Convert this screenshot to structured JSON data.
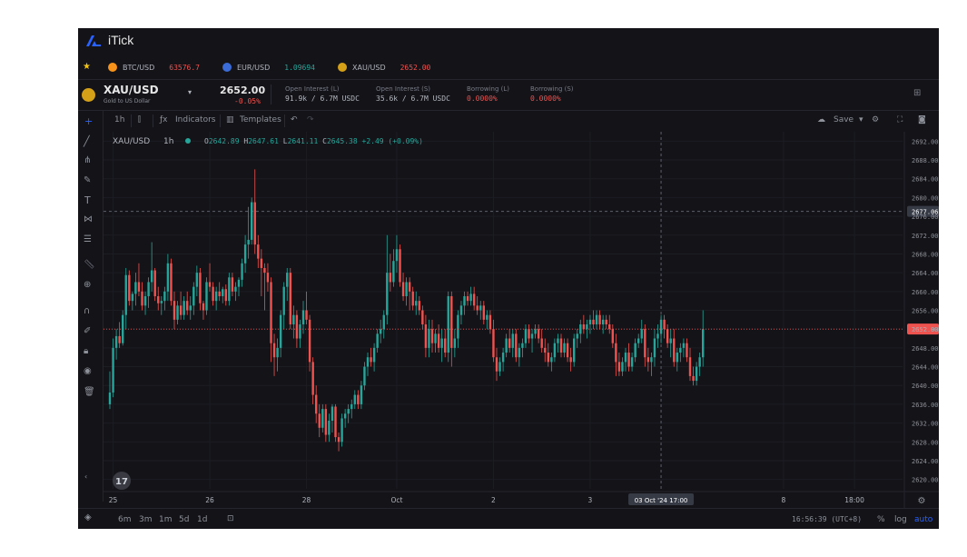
{
  "app": {
    "title": "iTick"
  },
  "watchlist": [
    {
      "symbol": "BTC/USD",
      "price": "63576.7",
      "price_color": "#ef5350",
      "coin_color": "#f7931a"
    },
    {
      "symbol": "EUR/USD",
      "price": "1.09694",
      "price_color": "#26a69a",
      "coin_color": "#3b6bd6"
    },
    {
      "symbol": "XAU/USD",
      "price": "2652.00",
      "price_color": "#ef5350",
      "coin_color": "#d4a017"
    }
  ],
  "symbol_header": {
    "symbol": "XAU/USD",
    "description": "Gold to US Dollar",
    "price": "2652.00",
    "change": "-0.05%",
    "stats": [
      {
        "label": "Open Interest (L)",
        "value": "91.9k / 6.7M USDC",
        "color": "#b2b5be"
      },
      {
        "label": "Open Interest (S)",
        "value": "35.6k / 6.7M USDC",
        "color": "#b2b5be"
      },
      {
        "label": "Borrowing (L)",
        "value": "0.0000%",
        "color": "#ef5350"
      },
      {
        "label": "Borrowing (S)",
        "value": "0.0000%",
        "color": "#ef5350"
      }
    ]
  },
  "toolbar": {
    "interval": "1h",
    "indicators": "Indicators",
    "templates": "Templates",
    "save": "Save"
  },
  "legend": {
    "symbol": "XAU/USD",
    "interval": "1h",
    "o": "2642.89",
    "h": "2647.61",
    "l": "2641.11",
    "c": "2645.38",
    "change": "+2.49 (+0.09%)"
  },
  "bottom": {
    "ranges": [
      "6m",
      "3m",
      "1m",
      "5d",
      "1d"
    ],
    "time": "16:56:39 (UTC+8)",
    "pct": "%",
    "log": "log",
    "auto": "auto"
  },
  "colors": {
    "up": "#26a69a",
    "down": "#ef5350",
    "accent": "#2962ff"
  },
  "chart_data": {
    "type": "candlestick",
    "title": "XAU/USD 1h",
    "ylim": [
      2618,
      2694
    ],
    "y_ticks": [
      "2692.00",
      "2688.00",
      "2684.00",
      "2680.00",
      "2676.00",
      "2672.00",
      "2668.00",
      "2664.00",
      "2660.00",
      "2656.00",
      "2652.00",
      "2648.00",
      "2644.00",
      "2640.00",
      "2636.00",
      "2632.00",
      "2628.00",
      "2624.00",
      "2620.00"
    ],
    "x_ticks": [
      {
        "label": "25",
        "bar": 1
      },
      {
        "label": "26",
        "bar": 31
      },
      {
        "label": "28",
        "bar": 61
      },
      {
        "label": "Oct",
        "bar": 89
      },
      {
        "label": "2",
        "bar": 119
      },
      {
        "label": "3",
        "bar": 149
      },
      {
        "label": "8",
        "bar": 209
      },
      {
        "label": "18:00",
        "bar": 231
      }
    ],
    "last_price": "2652.00",
    "last_price_value": 2652.0,
    "crosshair_price": "2677.06",
    "crosshair_price_value": 2677.06,
    "crosshair_time": "03 Oct '24  17:00",
    "crosshair_bar": 171,
    "ohlc": [
      [
        2636.0,
        2643.0,
        2635.0,
        2638.5
      ],
      [
        2638.5,
        2650.0,
        2637.5,
        2648.0
      ],
      [
        2648.0,
        2652.0,
        2645.5,
        2650.5
      ],
      [
        2650.5,
        2653.5,
        2648.0,
        2649.0
      ],
      [
        2649.0,
        2656.0,
        2648.5,
        2655.0
      ],
      [
        2655.0,
        2665.0,
        2652.0,
        2663.5
      ],
      [
        2663.5,
        2664.5,
        2657.0,
        2658.0
      ],
      [
        2658.0,
        2660.0,
        2656.0,
        2659.5
      ],
      [
        2659.5,
        2664.0,
        2657.0,
        2662.0
      ],
      [
        2662.0,
        2666.0,
        2659.0,
        2660.0
      ],
      [
        2660.0,
        2662.0,
        2656.0,
        2657.0
      ],
      [
        2657.0,
        2660.0,
        2655.0,
        2659.0
      ],
      [
        2659.0,
        2663.0,
        2656.5,
        2662.0
      ],
      [
        2662.0,
        2670.5,
        2660.0,
        2664.5
      ],
      [
        2664.5,
        2665.0,
        2658.0,
        2659.0
      ],
      [
        2659.0,
        2661.0,
        2656.0,
        2657.5
      ],
      [
        2657.5,
        2659.0,
        2655.0,
        2658.0
      ],
      [
        2658.0,
        2661.0,
        2656.0,
        2660.0
      ],
      [
        2660.0,
        2668.0,
        2658.0,
        2666.0
      ],
      [
        2666.0,
        2667.0,
        2657.0,
        2658.0
      ],
      [
        2658.0,
        2660.0,
        2652.0,
        2654.0
      ],
      [
        2654.0,
        2658.0,
        2653.0,
        2657.0
      ],
      [
        2657.0,
        2660.0,
        2654.0,
        2655.0
      ],
      [
        2655.0,
        2659.0,
        2654.0,
        2658.0
      ],
      [
        2658.0,
        2660.0,
        2655.0,
        2656.0
      ],
      [
        2656.0,
        2659.0,
        2654.0,
        2657.0
      ],
      [
        2657.0,
        2662.0,
        2655.0,
        2661.0
      ],
      [
        2661.0,
        2665.5,
        2659.0,
        2664.0
      ],
      [
        2664.0,
        2665.0,
        2656.0,
        2657.5
      ],
      [
        2657.5,
        2658.0,
        2654.0,
        2656.0
      ],
      [
        2656.0,
        2663.0,
        2655.0,
        2662.0
      ],
      [
        2662.0,
        2666.0,
        2660.0,
        2661.0
      ],
      [
        2661.0,
        2662.0,
        2657.0,
        2658.0
      ],
      [
        2658.0,
        2661.0,
        2656.0,
        2660.0
      ],
      [
        2660.0,
        2662.0,
        2658.0,
        2659.0
      ],
      [
        2659.0,
        2661.0,
        2657.5,
        2660.5
      ],
      [
        2660.5,
        2661.5,
        2657.0,
        2658.0
      ],
      [
        2658.0,
        2664.0,
        2657.0,
        2663.0
      ],
      [
        2663.0,
        2664.0,
        2659.0,
        2660.0
      ],
      [
        2660.0,
        2662.0,
        2658.0,
        2661.0
      ],
      [
        2661.0,
        2663.0,
        2659.0,
        2662.5
      ],
      [
        2662.5,
        2667.0,
        2661.0,
        2666.0
      ],
      [
        2666.0,
        2672.0,
        2664.0,
        2670.0
      ],
      [
        2670.0,
        2678.0,
        2667.0,
        2671.0
      ],
      [
        2671.0,
        2680.0,
        2670.0,
        2679.0
      ],
      [
        2679.0,
        2686.0,
        2668.0,
        2670.0
      ],
      [
        2670.0,
        2672.0,
        2665.0,
        2667.0
      ],
      [
        2667.0,
        2669.0,
        2659.0,
        2665.0
      ],
      [
        2665.0,
        2666.0,
        2656.0,
        2664.0
      ],
      [
        2664.0,
        2666.0,
        2660.0,
        2662.0
      ],
      [
        2662.0,
        2663.0,
        2645.0,
        2649.0
      ],
      [
        2649.0,
        2651.0,
        2642.0,
        2646.0
      ],
      [
        2646.0,
        2650.0,
        2643.0,
        2648.0
      ],
      [
        2648.0,
        2656.0,
        2646.0,
        2655.0
      ],
      [
        2655.0,
        2662.0,
        2652.0,
        2661.0
      ],
      [
        2661.0,
        2665.0,
        2658.0,
        2664.0
      ],
      [
        2664.0,
        2665.0,
        2652.0,
        2653.0
      ],
      [
        2653.0,
        2657.0,
        2650.0,
        2655.0
      ],
      [
        2655.0,
        2656.0,
        2648.0,
        2650.0
      ],
      [
        2650.0,
        2654.0,
        2648.0,
        2653.0
      ],
      [
        2653.0,
        2658.0,
        2651.0,
        2656.0
      ],
      [
        2656.0,
        2660.0,
        2653.0,
        2654.0
      ],
      [
        2654.0,
        2655.0,
        2643.0,
        2645.0
      ],
      [
        2645.0,
        2646.0,
        2636.0,
        2638.0
      ],
      [
        2638.0,
        2640.0,
        2632.0,
        2634.0
      ],
      [
        2634.0,
        2636.0,
        2629.0,
        2631.0
      ],
      [
        2631.0,
        2636.0,
        2630.0,
        2635.0
      ],
      [
        2635.0,
        2636.0,
        2628.0,
        2629.5
      ],
      [
        2629.5,
        2634.0,
        2628.0,
        2632.5
      ],
      [
        2632.5,
        2636.0,
        2630.0,
        2635.5
      ],
      [
        2635.5,
        2636.0,
        2628.0,
        2629.0
      ],
      [
        2629.0,
        2630.0,
        2626.0,
        2628.0
      ],
      [
        2628.0,
        2634.0,
        2627.0,
        2633.0
      ],
      [
        2633.0,
        2635.0,
        2631.0,
        2634.0
      ],
      [
        2634.0,
        2636.0,
        2632.0,
        2635.0
      ],
      [
        2635.0,
        2637.0,
        2633.0,
        2636.0
      ],
      [
        2636.0,
        2639.0,
        2635.0,
        2638.0
      ],
      [
        2638.0,
        2639.0,
        2635.0,
        2636.0
      ],
      [
        2636.0,
        2641.0,
        2635.0,
        2640.0
      ],
      [
        2640.0,
        2645.0,
        2639.0,
        2644.0
      ],
      [
        2644.0,
        2647.0,
        2642.0,
        2646.0
      ],
      [
        2646.0,
        2648.0,
        2644.0,
        2645.0
      ],
      [
        2645.0,
        2649.0,
        2643.0,
        2648.0
      ],
      [
        2648.0,
        2652.0,
        2647.0,
        2651.0
      ],
      [
        2651.0,
        2654.0,
        2649.0,
        2652.0
      ],
      [
        2652.0,
        2656.0,
        2650.0,
        2655.0
      ],
      [
        2655.0,
        2672.0,
        2653.0,
        2664.0
      ],
      [
        2664.0,
        2668.0,
        2660.0,
        2662.0
      ],
      [
        2662.0,
        2669.0,
        2661.0,
        2666.5
      ],
      [
        2666.5,
        2672.0,
        2664.0,
        2669.0
      ],
      [
        2669.0,
        2670.0,
        2661.0,
        2662.0
      ],
      [
        2662.0,
        2664.0,
        2658.0,
        2659.0
      ],
      [
        2659.0,
        2663.0,
        2657.0,
        2662.0
      ],
      [
        2662.0,
        2663.0,
        2656.0,
        2660.0
      ],
      [
        2660.0,
        2661.0,
        2656.0,
        2657.0
      ],
      [
        2657.0,
        2660.0,
        2655.0,
        2658.0
      ],
      [
        2658.0,
        2659.0,
        2655.0,
        2656.0
      ],
      [
        2656.0,
        2657.0,
        2652.0,
        2653.0
      ],
      [
        2653.0,
        2655.0,
        2646.0,
        2648.0
      ],
      [
        2648.0,
        2654.0,
        2646.0,
        2652.0
      ],
      [
        2652.0,
        2654.0,
        2647.0,
        2649.0
      ],
      [
        2649.0,
        2652.0,
        2647.0,
        2651.0
      ],
      [
        2651.0,
        2653.0,
        2647.0,
        2648.0
      ],
      [
        2648.0,
        2652.0,
        2645.0,
        2650.0
      ],
      [
        2650.0,
        2652.0,
        2646.0,
        2647.0
      ],
      [
        2647.0,
        2660.0,
        2645.0,
        2659.0
      ],
      [
        2659.0,
        2660.0,
        2644.0,
        2648.0
      ],
      [
        2648.0,
        2652.0,
        2646.0,
        2650.0
      ],
      [
        2650.0,
        2656.0,
        2648.0,
        2655.0
      ],
      [
        2655.0,
        2658.0,
        2653.0,
        2657.0
      ],
      [
        2657.0,
        2660.0,
        2655.0,
        2659.0
      ],
      [
        2659.0,
        2660.0,
        2657.0,
        2658.0
      ],
      [
        2658.0,
        2661.0,
        2657.0,
        2659.5
      ],
      [
        2659.5,
        2661.0,
        2656.0,
        2657.0
      ],
      [
        2657.0,
        2659.0,
        2655.0,
        2656.0
      ],
      [
        2656.0,
        2658.0,
        2654.0,
        2657.0
      ],
      [
        2657.0,
        2658.0,
        2653.0,
        2654.0
      ],
      [
        2654.0,
        2656.0,
        2652.0,
        2655.0
      ],
      [
        2655.0,
        2656.0,
        2651.0,
        2652.0
      ],
      [
        2652.0,
        2654.0,
        2645.0,
        2646.0
      ],
      [
        2646.0,
        2648.0,
        2641.0,
        2643.0
      ],
      [
        2643.0,
        2646.0,
        2642.0,
        2645.0
      ],
      [
        2645.0,
        2648.0,
        2643.0,
        2647.0
      ],
      [
        2647.0,
        2651.0,
        2646.0,
        2650.0
      ],
      [
        2650.0,
        2652.0,
        2647.0,
        2648.0
      ],
      [
        2648.0,
        2652.0,
        2646.0,
        2651.0
      ],
      [
        2651.0,
        2652.0,
        2645.0,
        2646.0
      ],
      [
        2646.0,
        2649.0,
        2644.0,
        2648.0
      ],
      [
        2648.0,
        2650.0,
        2646.0,
        2649.0
      ],
      [
        2649.0,
        2653.0,
        2648.0,
        2652.0
      ],
      [
        2652.0,
        2653.0,
        2649.0,
        2650.0
      ],
      [
        2650.0,
        2652.0,
        2647.0,
        2651.0
      ],
      [
        2651.0,
        2653.0,
        2650.0,
        2652.0
      ],
      [
        2652.0,
        2653.0,
        2649.0,
        2650.0
      ],
      [
        2650.0,
        2652.0,
        2647.0,
        2648.0
      ],
      [
        2648.0,
        2650.0,
        2645.0,
        2647.0
      ],
      [
        2647.0,
        2649.0,
        2644.0,
        2645.0
      ],
      [
        2645.0,
        2647.0,
        2643.0,
        2646.0
      ],
      [
        2646.0,
        2650.0,
        2645.0,
        2649.0
      ],
      [
        2649.0,
        2651.0,
        2647.0,
        2650.0
      ],
      [
        2650.0,
        2651.0,
        2646.0,
        2647.0
      ],
      [
        2647.0,
        2650.0,
        2646.0,
        2649.0
      ],
      [
        2649.0,
        2650.0,
        2645.0,
        2646.0
      ],
      [
        2646.0,
        2648.0,
        2643.0,
        2645.0
      ],
      [
        2645.0,
        2651.0,
        2644.0,
        2650.0
      ],
      [
        2650.0,
        2652.0,
        2648.0,
        2651.0
      ],
      [
        2651.0,
        2654.0,
        2649.0,
        2653.0
      ],
      [
        2653.0,
        2655.0,
        2651.0,
        2652.0
      ],
      [
        2652.0,
        2654.0,
        2650.0,
        2653.0
      ],
      [
        2653.0,
        2655.0,
        2651.0,
        2654.0
      ],
      [
        2654.0,
        2656.0,
        2652.0,
        2653.0
      ],
      [
        2653.0,
        2656.0,
        2652.0,
        2655.0
      ],
      [
        2655.0,
        2656.0,
        2652.0,
        2653.0
      ],
      [
        2653.0,
        2655.0,
        2651.0,
        2654.0
      ],
      [
        2654.0,
        2655.0,
        2652.0,
        2653.0
      ],
      [
        2653.0,
        2655.0,
        2651.0,
        2652.0
      ],
      [
        2652.0,
        2653.0,
        2648.0,
        2649.0
      ],
      [
        2649.0,
        2651.0,
        2642.0,
        2645.0
      ],
      [
        2645.0,
        2647.0,
        2642.0,
        2643.0
      ],
      [
        2643.0,
        2646.0,
        2642.0,
        2645.0
      ],
      [
        2645.0,
        2648.0,
        2643.0,
        2647.0
      ],
      [
        2647.0,
        2649.0,
        2643.0,
        2644.0
      ],
      [
        2644.0,
        2647.0,
        2643.0,
        2646.0
      ],
      [
        2646.0,
        2650.0,
        2645.0,
        2649.0
      ],
      [
        2649.0,
        2651.0,
        2648.0,
        2650.0
      ],
      [
        2650.0,
        2654.0,
        2649.0,
        2652.0
      ],
      [
        2652.0,
        2653.0,
        2644.0,
        2646.0
      ],
      [
        2646.0,
        2648.0,
        2643.0,
        2645.0
      ],
      [
        2645.0,
        2647.0,
        2642.0,
        2646.0
      ],
      [
        2646.0,
        2652.0,
        2644.0,
        2650.0
      ],
      [
        2650.0,
        2653.0,
        2648.0,
        2651.0
      ],
      [
        2651.0,
        2655.0,
        2649.0,
        2654.0
      ],
      [
        2654.0,
        2655.0,
        2650.0,
        2652.0
      ],
      [
        2652.0,
        2653.0,
        2648.0,
        2649.0
      ],
      [
        2649.0,
        2652.0,
        2646.0,
        2650.0
      ],
      [
        2650.0,
        2652.0,
        2644.0,
        2645.0
      ],
      [
        2645.0,
        2648.0,
        2643.0,
        2647.0
      ],
      [
        2647.0,
        2649.0,
        2645.0,
        2648.0
      ],
      [
        2648.0,
        2650.0,
        2646.0,
        2649.0
      ],
      [
        2649.0,
        2650.0,
        2645.0,
        2646.0
      ],
      [
        2646.0,
        2648.0,
        2641.0,
        2642.0
      ],
      [
        2642.0,
        2644.0,
        2640.0,
        2641.0
      ],
      [
        2641.0,
        2645.0,
        2640.0,
        2644.0
      ],
      [
        2644.0,
        2647.0,
        2642.0,
        2646.0
      ],
      [
        2646.0,
        2656.0,
        2644.0,
        2652.0
      ]
    ]
  }
}
